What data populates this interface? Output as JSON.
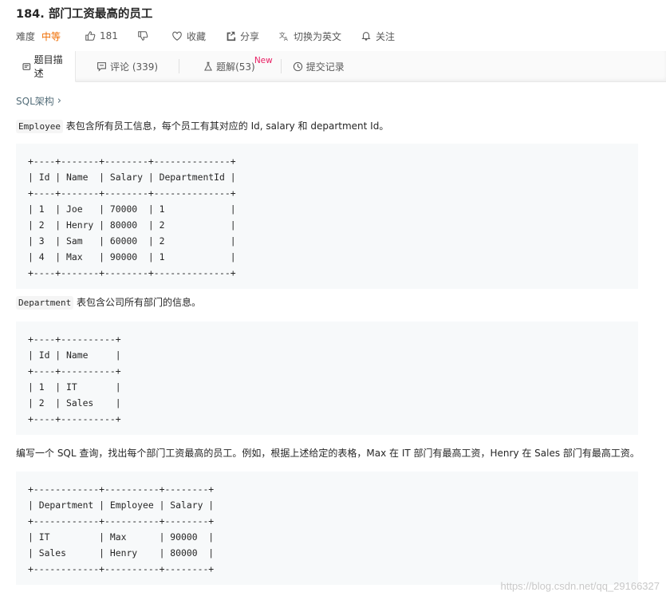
{
  "problem": {
    "title": "184. 部门工资最高的员工",
    "difficulty_label": "难度",
    "difficulty_value": "中等",
    "likes": "181",
    "favorite_label": "收藏",
    "share_label": "分享",
    "translate_label": "切换为英文",
    "follow_label": "关注"
  },
  "tabs": [
    {
      "label": "题目描述"
    },
    {
      "label": "评论 (339)"
    },
    {
      "label": "题解(53)",
      "badge": "New"
    },
    {
      "label": "提交记录"
    }
  ],
  "content": {
    "breadcrumb": "SQL架构",
    "table1_name": "Employee",
    "table1_desc": " 表包含所有员工信息，每个员工有其对应的 Id, salary 和 department Id。",
    "table1_block": "+----+-------+--------+--------------+\n| Id | Name  | Salary | DepartmentId |\n+----+-------+--------+--------------+\n| 1  | Joe   | 70000  | 1            |\n| 2  | Henry | 80000  | 2            |\n| 3  | Sam   | 60000  | 2            |\n| 4  | Max   | 90000  | 1            |\n+----+-------+--------+--------------+",
    "table2_name": "Department",
    "table2_desc": " 表包含公司所有部门的信息。",
    "table2_block": "+----+----------+\n| Id | Name     |\n+----+----------+\n| 1  | IT       |\n| 2  | Sales    |\n+----+----------+",
    "question": "编写一个 SQL 查询，找出每个部门工资最高的员工。例如，根据上述给定的表格，Max 在 IT 部门有最高工资，Henry 在 Sales 部门有最高工资。",
    "result_block": "+------------+----------+--------+\n| Department | Employee | Salary |\n+------------+----------+--------+\n| IT         | Max      | 90000  |\n| Sales      | Henry    | 80000  |\n+------------+----------+--------+"
  },
  "watermark": "https://blog.csdn.net/qq_29166327",
  "colors": {
    "difficulty": "#ef6c00",
    "new_badge": "#e91e63"
  }
}
